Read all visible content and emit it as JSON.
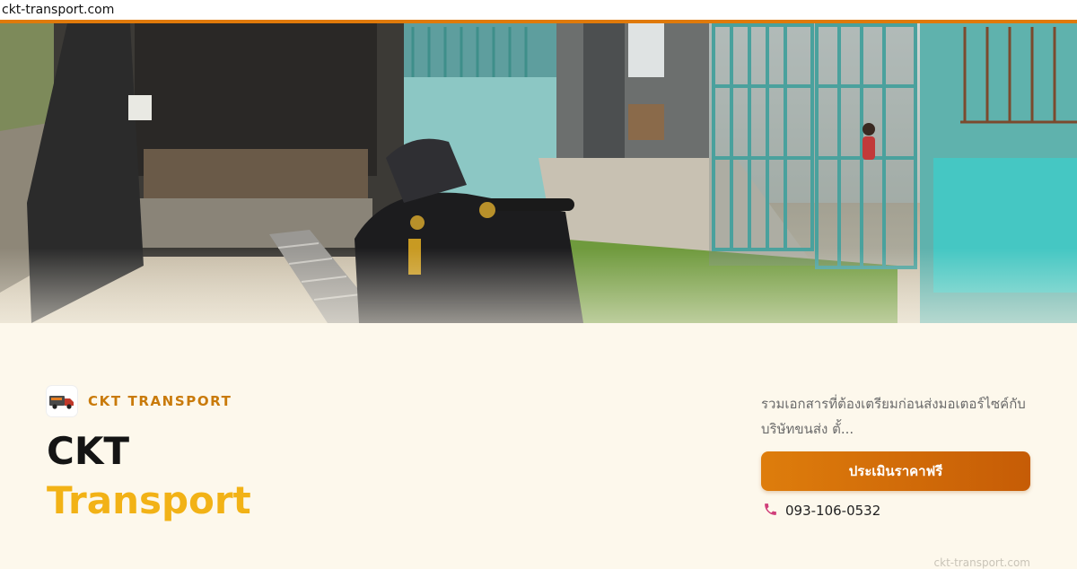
{
  "browser": {
    "url": "ckt-transport.com"
  },
  "hero": {
    "image_description_icon": "photo-truck-motorcycle"
  },
  "brand": {
    "name": "CKT TRANSPORT",
    "logo_icon": "truck-logo-icon"
  },
  "title": {
    "line1": "CKT",
    "line2": "Transport"
  },
  "description": "รวมเอกสารที่ต้องเตรียมก่อนส่งมอเตอร์ไซค์กับบริษัทขนส่ง ตั้...",
  "cta": {
    "label": "ประเมินราคาฟรี"
  },
  "contact": {
    "phone": "093-106-0532",
    "phone_icon": "phone-icon"
  },
  "footer": {
    "domain": "ckt-transport.com"
  },
  "colors": {
    "accent": "#e07a0a",
    "brand_text": "#c97a0a",
    "title_highlight": "#f2b216",
    "background": "#fdf8ec",
    "cta_start": "#de7d0c",
    "cta_end": "#c65c06",
    "phone_icon": "#d03f7a"
  }
}
